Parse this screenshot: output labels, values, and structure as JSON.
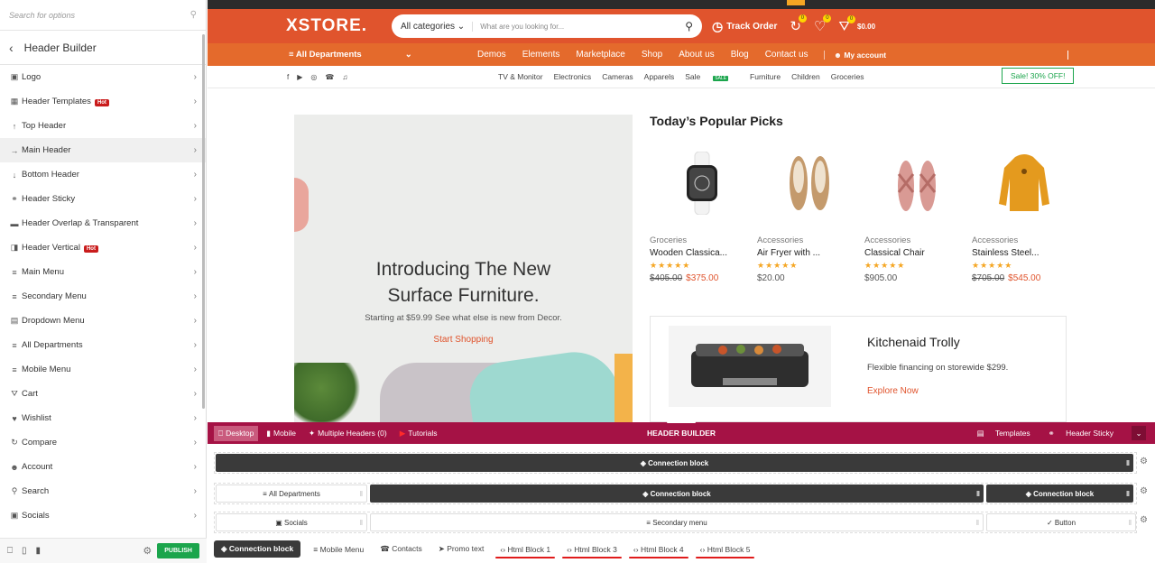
{
  "sidebar": {
    "search_placeholder": "Search for options",
    "title": "Header Builder",
    "items": [
      {
        "label": "Logo",
        "icon": "image-icon"
      },
      {
        "label": "Header Templates",
        "icon": "grid-icon",
        "badge": "Hot"
      },
      {
        "label": "Top Header",
        "icon": "arrow-up-icon"
      },
      {
        "label": "Main Header",
        "icon": "arrow-right-icon"
      },
      {
        "label": "Bottom Header",
        "icon": "arrow-down-icon"
      },
      {
        "label": "Header Sticky",
        "icon": "pin-icon"
      },
      {
        "label": "Header Overlap & Transparent",
        "icon": "layers-icon"
      },
      {
        "label": "Header Vertical",
        "icon": "sidebar-icon",
        "badge": "Hot"
      },
      {
        "label": "Main Menu",
        "icon": "menu-icon"
      },
      {
        "label": "Secondary Menu",
        "icon": "menu-icon"
      },
      {
        "label": "Dropdown Menu",
        "icon": "dropdown-icon"
      },
      {
        "label": "All Departments",
        "icon": "menu-icon"
      },
      {
        "label": "Mobile Menu",
        "icon": "menu-icon"
      },
      {
        "label": "Cart",
        "icon": "cart-icon"
      },
      {
        "label": "Wishlist",
        "icon": "heart-icon"
      },
      {
        "label": "Compare",
        "icon": "compare-icon"
      },
      {
        "label": "Account",
        "icon": "user-icon"
      },
      {
        "label": "Search",
        "icon": "search-icon"
      },
      {
        "label": "Socials",
        "icon": "facebook-icon"
      }
    ],
    "publish": "PUBLISH"
  },
  "site": {
    "logo": "XSTORE.",
    "search_category": "All categories",
    "search_placeholder": "What are you looking for...",
    "track_order": "Track Order",
    "compare_count": "0",
    "wishlist_count": "0",
    "cart_count": "0",
    "cart_total": "$0.00",
    "all_departments": "All Departments",
    "nav": [
      "Demos",
      "Elements",
      "Marketplace",
      "Shop",
      "About us",
      "Blog",
      "Contact us"
    ],
    "my_account": "My account",
    "categories": [
      "TV & Monitor",
      "Electronics",
      "Cameras",
      "Apparels",
      "Sale",
      "Furniture",
      "Children",
      "Groceries"
    ],
    "sale_badge": "SALE",
    "sale_button": "Sale! 30% OFF!",
    "hero": {
      "title_line1": "Introducing The New",
      "title_line2": "Surface Furniture.",
      "subtitle": "Starting at $59.99 See what else is new from Decor.",
      "cta": "Start Shopping"
    },
    "picks_title": "Today’s Popular Picks",
    "products": [
      {
        "category": "Groceries",
        "name": "Wooden Classica...",
        "old_price": "$405.00",
        "price": "$375.00",
        "rating": 5
      },
      {
        "category": "Accessories",
        "name": "Air Fryer with ...",
        "old_price": "",
        "price": "$20.00",
        "rating": 5
      },
      {
        "category": "Accessories",
        "name": "Classical Chair",
        "old_price": "",
        "price": "$905.00",
        "rating": 5
      },
      {
        "category": "Accessories",
        "name": "Stainless Steel...",
        "old_price": "$705.00",
        "price": "$545.00",
        "rating": 5
      }
    ],
    "promo": {
      "title": "Kitchenaid Trolly",
      "text": "Flexible financing on storewide $299.",
      "link": "Explore Now"
    }
  },
  "builder": {
    "tabs": {
      "desktop": "Desktop",
      "mobile": "Mobile",
      "multiple": "Multiple Headers (0)",
      "tutorials": "Tutorials"
    },
    "title": "HEADER BUILDER",
    "templates": "Templates",
    "header_sticky": "Header Sticky",
    "row1": [
      "Connection block"
    ],
    "row2": [
      "All Departments",
      "Connection block",
      "Connection block"
    ],
    "row3": [
      "Socials",
      "Secondary menu",
      "Button"
    ],
    "available": [
      "Connection block",
      "Mobile Menu",
      "Contacts",
      "Promo text",
      "Html Block 1",
      "Html Block 3",
      "Html Block 4",
      "Html Block 5"
    ]
  },
  "colors": {
    "brand": "#e0542d",
    "builder_bar": "#a51245",
    "publish": "#1ba54c"
  }
}
